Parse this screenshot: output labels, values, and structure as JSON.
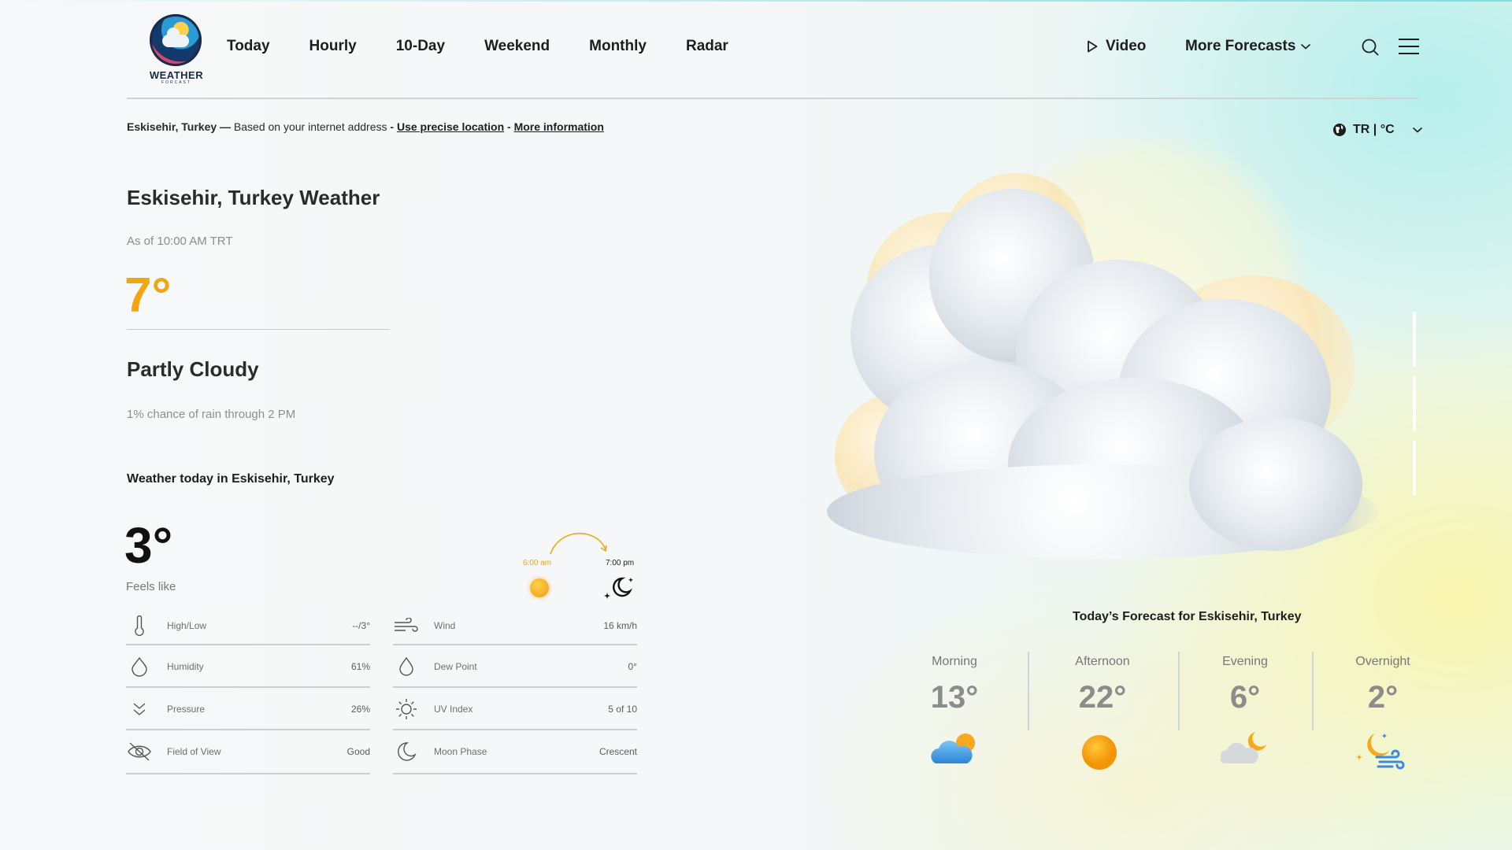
{
  "nav": {
    "items": [
      "Today",
      "Hourly",
      "10-Day",
      "Weekend",
      "Monthly",
      "Radar"
    ],
    "video_label": "Video",
    "more_label": "More Forecasts"
  },
  "logo": {
    "word": "WEATHER",
    "sub": "FORCAST"
  },
  "location_bar": {
    "place": "Eskisehir, Turkey",
    "dash": " — ",
    "based": "Based on your internet address ",
    "sep1": "- ",
    "precise_link": "Use precise location",
    "sep2": " - ",
    "more_link": "More information"
  },
  "unit_selector": {
    "label": "TR | °C"
  },
  "current": {
    "title": "Eskisehir, Turkey Weather",
    "as_of": "As of 10:00 AM TRT",
    "temperature": "7°",
    "condition": "Partly Cloudy",
    "rain_note": "1% chance of rain through 2 PM"
  },
  "today": {
    "heading": "Weather today in Eskisehir, Turkey",
    "feels_like_temp": "3°",
    "feels_like_label": "Feels like",
    "sunrise": "6:00 am",
    "sunset": "7:00 pm",
    "details": [
      {
        "icon": "thermometer-icon",
        "label": "High/Low",
        "value": "--/3°"
      },
      {
        "icon": "wind-icon",
        "label": "Wind",
        "value": "16 km/h"
      },
      {
        "icon": "humidity-drop-icon",
        "label": "Humidity",
        "value": "61%"
      },
      {
        "icon": "dew-point-drop-icon",
        "label": "Dew Point",
        "value": "0°"
      },
      {
        "icon": "pressure-chevrons-icon",
        "label": "Pressure",
        "value": "26%"
      },
      {
        "icon": "sun-uv-icon",
        "label": "UV Index",
        "value": "5 of 10"
      },
      {
        "icon": "eye-off-icon",
        "label": "Field of View",
        "value": "Good"
      },
      {
        "icon": "moon-phase-icon",
        "label": "Moon Phase",
        "value": "Crescent"
      }
    ]
  },
  "forecast": {
    "title": "Today’s Forecast for Eskisehir, Turkey",
    "periods": [
      {
        "name": "Morning",
        "temp": "13°",
        "icon": "partly-cloudy-sun-icon"
      },
      {
        "name": "Afternoon",
        "temp": "22°",
        "icon": "sun-icon"
      },
      {
        "name": "Evening",
        "temp": "6°",
        "icon": "cloudy-moon-icon"
      },
      {
        "name": "Overnight",
        "temp": "2°",
        "icon": "moon-wind-icon"
      }
    ]
  },
  "colors": {
    "accent": "#f2a50f",
    "text": "#1e1e1e",
    "muted": "#8c8c8c"
  }
}
